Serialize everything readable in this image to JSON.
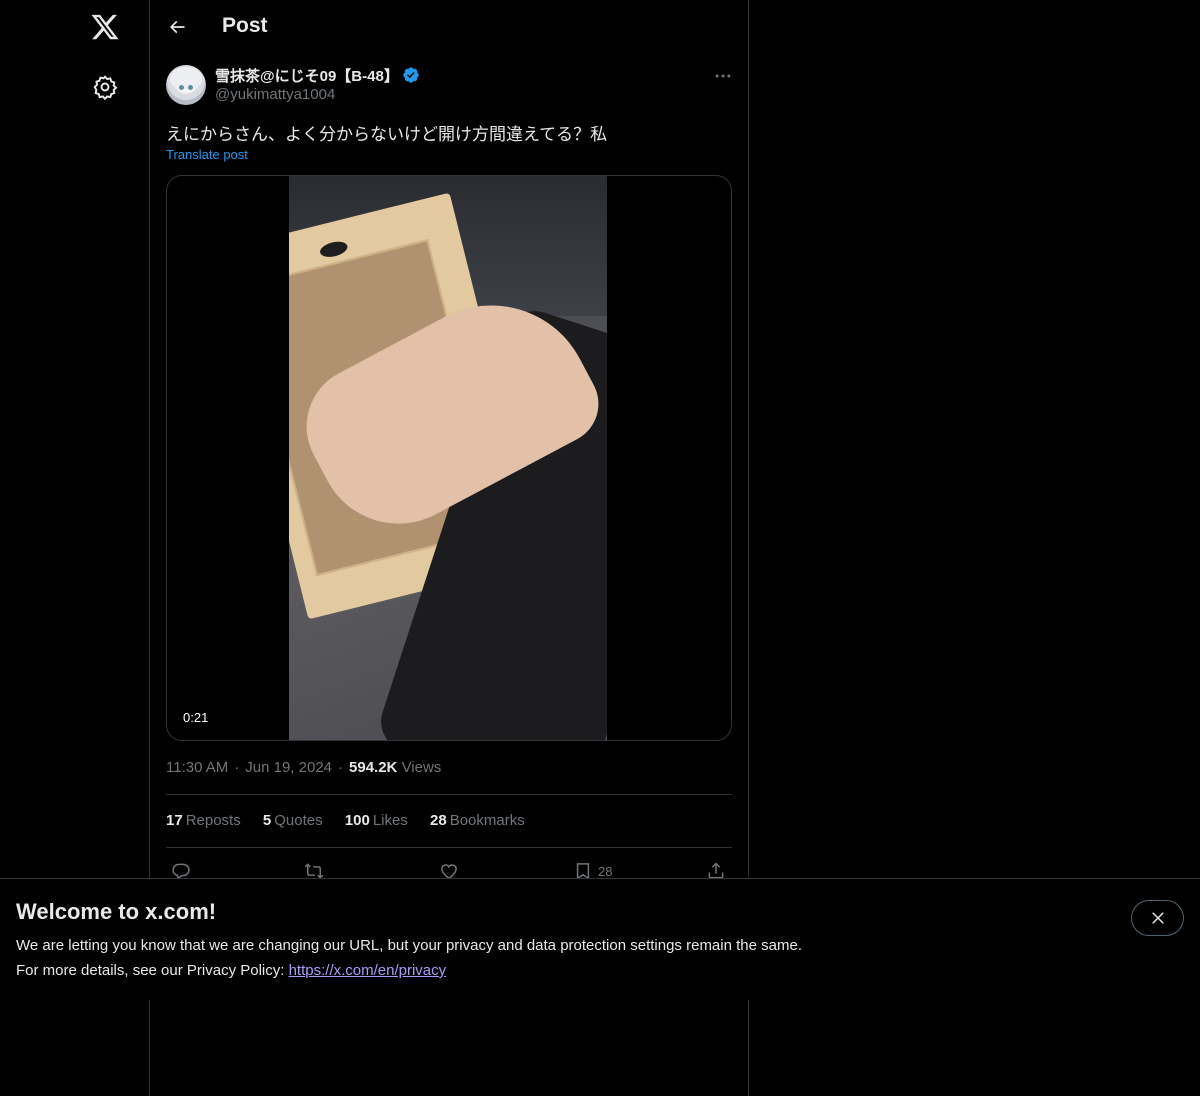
{
  "header": {
    "title": "Post"
  },
  "post": {
    "author_name": "雪抹茶@にじそ09【B-48】",
    "author_handle": "@yukimattya1004",
    "text": "えにからさん、よく分からないけど開け方間違えてる？私",
    "translate_label": "Translate post",
    "video_duration": "0:21",
    "time": "11:30 AM",
    "date": "Jun 19, 2024",
    "views_count": "594.2K",
    "views_label": "Views"
  },
  "stats": {
    "reposts": {
      "count": "17",
      "label": "Reposts"
    },
    "quotes": {
      "count": "5",
      "label": "Quotes"
    },
    "likes": {
      "count": "100",
      "label": "Likes"
    },
    "bookmarks": {
      "count": "28",
      "label": "Bookmarks"
    }
  },
  "actions": {
    "bookmark_count": "28"
  },
  "banner": {
    "title": "Welcome to x.com!",
    "line1": "We are letting you know that we are changing our URL, but your privacy and data protection settings remain the same.",
    "line2_prefix": "For more details, see our Privacy Policy: ",
    "link": "https://x.com/en/privacy"
  },
  "colors": {
    "accent": "#1d9bf0",
    "muted": "#71767b",
    "text": "#e7e9ea",
    "border": "#2f3336",
    "link": "#a99cff"
  },
  "icons": [
    "x-logo-icon",
    "settings-icon",
    "back-arrow-icon",
    "verified-badge-icon",
    "more-icon",
    "reply-icon",
    "repost-icon",
    "like-icon",
    "bookmark-icon",
    "share-icon",
    "close-icon"
  ]
}
